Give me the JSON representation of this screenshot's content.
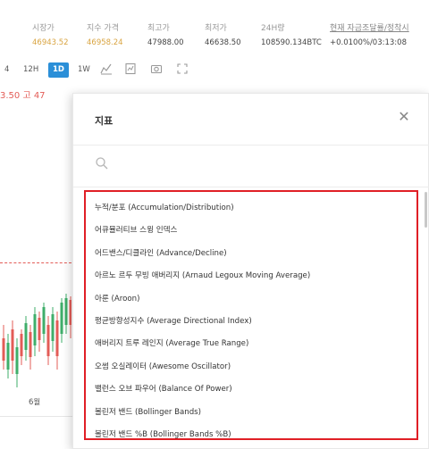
{
  "stats": [
    {
      "label": "시장가",
      "value": "46943.52",
      "value_color": "orange"
    },
    {
      "label": "지수 가격",
      "value": "46958.24",
      "value_color": "orange"
    },
    {
      "label": "최고가",
      "value": "47988.00",
      "value_color": "normal"
    },
    {
      "label": "최저가",
      "value": "46638.50",
      "value_color": "normal"
    },
    {
      "label": "24H량",
      "value": "108590.134BTC",
      "value_color": "normal"
    },
    {
      "label": "현재 자금조달률/정착시",
      "value": "+0.0100%/03:13:08",
      "value_color": "normal"
    }
  ],
  "toolbar": {
    "interval_partial": "4",
    "interval_12h": "12H",
    "interval_1d": "1D",
    "interval_1w": "1W",
    "icons": [
      "chart-type-icon",
      "indicators-icon",
      "camera-icon",
      "fullscreen-icon"
    ]
  },
  "chart": {
    "price_text": "3.50  고 47",
    "axis_label": "6월"
  },
  "modal": {
    "title": "지표",
    "close_glyph": "✕",
    "search_placeholder": "",
    "items": [
      "누적/분포 (Accumulation/Distribution)",
      "어큐뮬러티브 스윙 인덱스",
      "어드밴스/디클라인 (Advance/Decline)",
      "아르노 르두 무빙 애버리지 (Arnaud Legoux Moving Average)",
      "아룬 (Aroon)",
      "평균방향성지수 (Average Directional Index)",
      "애버리지 트루 레인지 (Average True Range)",
      "오썸 오실레이터 (Awesome Oscillator)",
      "밸런스 오브 파우어 (Balance Of Power)",
      "볼린저 밴드 (Bollinger Bands)",
      "볼린저 밴드 %B (Bollinger Bands %B)"
    ]
  },
  "colors": {
    "accent": "#2b8fd8",
    "highlight_border": "#e01f26",
    "price_orange": "#d9a441",
    "down_red": "#e35c57",
    "up_green": "#3fae6a"
  }
}
